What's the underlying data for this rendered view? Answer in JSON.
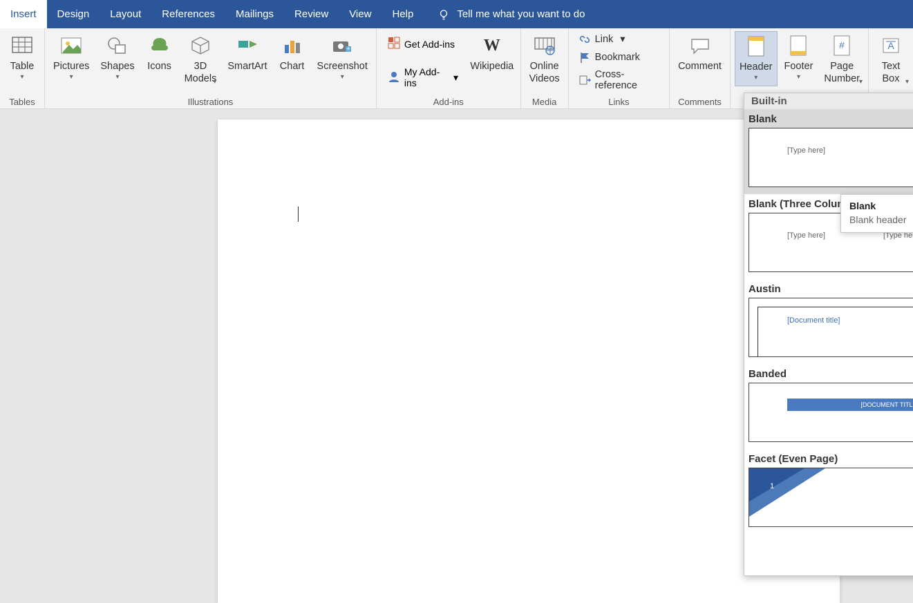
{
  "tabs": [
    "Insert",
    "Design",
    "Layout",
    "References",
    "Mailings",
    "Review",
    "View",
    "Help"
  ],
  "active_tab_index": 0,
  "tell_me": "Tell me what you want to do",
  "ribbon": {
    "tables": {
      "label": "Tables",
      "table": "Table"
    },
    "illustrations": {
      "label": "Illustrations",
      "pictures": "Pictures",
      "shapes": "Shapes",
      "icons": "Icons",
      "models": "3D\nModels",
      "smartart": "SmartArt",
      "chart": "Chart",
      "screenshot": "Screenshot"
    },
    "addins": {
      "label": "Add-ins",
      "get": "Get Add-ins",
      "my": "My Add-ins",
      "wikipedia": "Wikipedia"
    },
    "media": {
      "label": "Media",
      "online": "Online\nVideos"
    },
    "links": {
      "label": "Links",
      "link": "Link",
      "bookmark": "Bookmark",
      "crossref": "Cross-reference"
    },
    "comments": {
      "label": "Comments",
      "comment": "Comment"
    },
    "hf": {
      "header": "Header",
      "footer": "Footer",
      "pagenum": "Page\nNumber"
    },
    "text": {
      "textbox": "Text\nBox"
    }
  },
  "gallery": {
    "section": "Built-in",
    "items": [
      {
        "title": "Blank",
        "hover": true,
        "placeholders": [
          "[Type here]"
        ]
      },
      {
        "title": "Blank (Three Columns)",
        "placeholders": [
          "[Type here]",
          "[Type here]"
        ]
      },
      {
        "title": "Austin",
        "placeholders": [
          "[Document title]"
        ]
      },
      {
        "title": "Banded",
        "placeholders": [
          "[DOCUMENT TITLE]"
        ]
      },
      {
        "title": "Facet (Even Page)",
        "placeholders": [
          "1"
        ]
      }
    ]
  },
  "tooltip": {
    "title": "Blank",
    "desc": "Blank header"
  }
}
